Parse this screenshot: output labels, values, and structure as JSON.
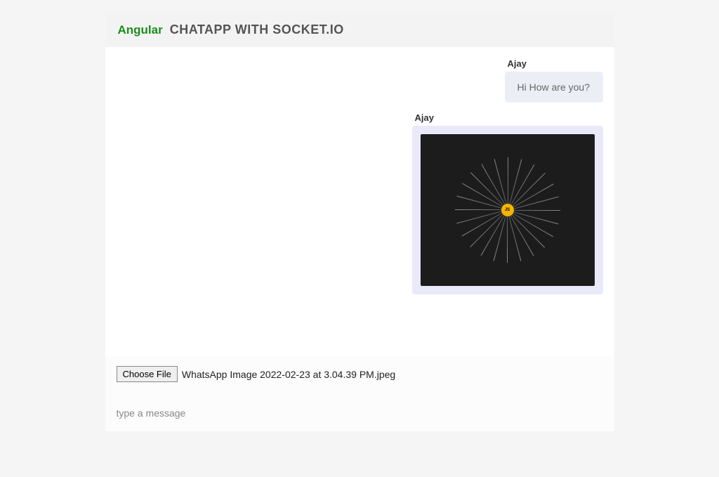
{
  "header": {
    "brand": "Angular",
    "title": "CHATAPP WITH SOCKET.IO"
  },
  "messages": [
    {
      "sender": "Ajay",
      "type": "text",
      "text": "Hi How are you?"
    },
    {
      "sender": "Ajay",
      "type": "image",
      "image_core_label": "JS"
    }
  ],
  "footer": {
    "choose_file_label": "Choose File",
    "selected_file_name": "WhatsApp Image 2022-02-23 at 3.04.39 PM.jpeg",
    "input_placeholder": "type a message"
  }
}
